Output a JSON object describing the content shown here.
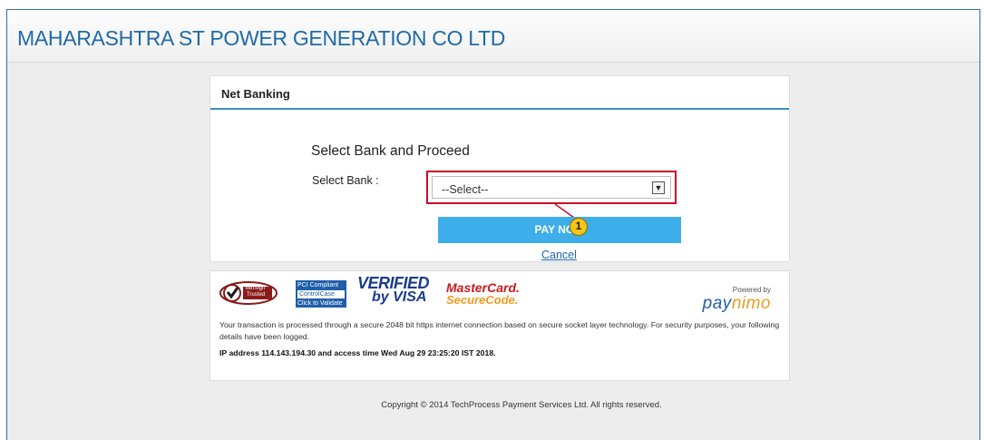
{
  "header": {
    "company_name": "MAHARASHTRA ST POWER GENERATION CO LTD"
  },
  "card": {
    "title": "Net Banking",
    "section_title": "Select Bank and Proceed",
    "select_label": "Select Bank :",
    "select_value": "--Select--",
    "pay_button_label": "PAY NOW",
    "callout_number": "1",
    "cancel_label": "Cancel"
  },
  "info": {
    "logos": {
      "verisign_line1": "VeriSign",
      "verisign_line2": "Trusted",
      "pci_top": "PCI Compliant",
      "pci_mid": "ControlCase",
      "pci_bottom": "Click to Validate",
      "visa_line1": "VERIFIED",
      "visa_line2": "by VISA",
      "mc_line1": "MasterCard.",
      "mc_line2": "SecureCode."
    },
    "powered_by": "Powered by",
    "brand_pay": "pay",
    "brand_nimo": "nimo",
    "security_text": "Your transaction is processed through a secure 2048 bit https internet connection based on secure socket layer technology. For security purposes, your following details have been logged.",
    "ip_text": "IP address 114.143.194.30 and access time Wed Aug 29 23:25:20 IST 2018."
  },
  "footer": {
    "copyright": "Copyright © 2014 TechProcess Payment Services Ltd. All rights reserved."
  },
  "colors": {
    "accent": "#1f6aa8",
    "highlight": "#c8102e",
    "button": "#3daee9",
    "callout": "#f5c518"
  }
}
